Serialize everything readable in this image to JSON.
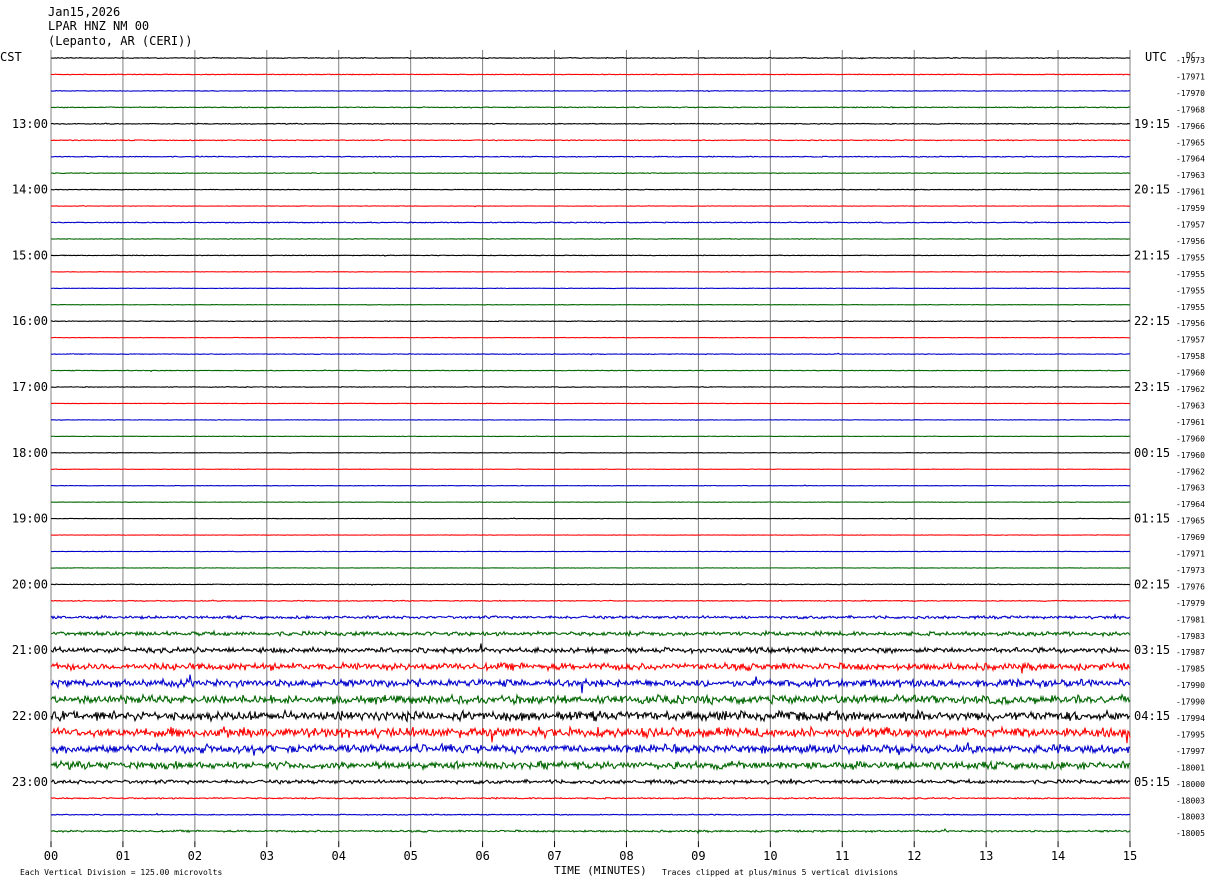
{
  "header": {
    "date": "Jan15,2026",
    "station": "LPAR HNZ NM 00",
    "location": "(Lepanto, AR (CERI))"
  },
  "left_tz": "CST",
  "right_tz": "UTC",
  "right_unit": "DC",
  "footer": {
    "scale_note": "Each Vertical Division =  125.00 microvolts",
    "xlabel": "TIME (MINUTES)",
    "clip_note": "Traces clipped at plus/minus 5 vertical divisions"
  },
  "colors": {
    "black": "#000000",
    "red": "#ff0000",
    "blue": "#0000cc",
    "green": "#006600",
    "grid": "#808080"
  },
  "chart_data": {
    "type": "line",
    "title": "LPAR HNZ NM 00 helicorder Jan15,2026",
    "xlabel": "TIME (MINUTES)",
    "xlim": [
      0,
      15
    ],
    "x_ticks": [
      "00",
      "01",
      "02",
      "03",
      "04",
      "05",
      "06",
      "07",
      "08",
      "09",
      "10",
      "11",
      "12",
      "13",
      "14",
      "15"
    ],
    "grid": true,
    "trace_colors": [
      "black",
      "red",
      "blue",
      "green"
    ],
    "rows": [
      {
        "cst": "",
        "utc": "",
        "dc": "-17973",
        "activity": 0.4
      },
      {
        "cst": "",
        "utc": "",
        "dc": "-17971",
        "activity": 0.3
      },
      {
        "cst": "",
        "utc": "",
        "dc": "-17970",
        "activity": 0.3
      },
      {
        "cst": "",
        "utc": "",
        "dc": "-17968",
        "activity": 0.4
      },
      {
        "cst": "13:00",
        "utc": "19:15",
        "dc": "-17966",
        "activity": 0.4
      },
      {
        "cst": "",
        "utc": "",
        "dc": "-17965",
        "activity": 0.4
      },
      {
        "cst": "",
        "utc": "",
        "dc": "-17964",
        "activity": 0.4
      },
      {
        "cst": "",
        "utc": "",
        "dc": "-17963",
        "activity": 0.3
      },
      {
        "cst": "14:00",
        "utc": "20:15",
        "dc": "-17961",
        "activity": 0.3
      },
      {
        "cst": "",
        "utc": "",
        "dc": "-17959",
        "activity": 0.2
      },
      {
        "cst": "",
        "utc": "",
        "dc": "-17957",
        "activity": 0.4
      },
      {
        "cst": "",
        "utc": "",
        "dc": "-17956",
        "activity": 0.3
      },
      {
        "cst": "15:00",
        "utc": "21:15",
        "dc": "-17955",
        "activity": 0.3
      },
      {
        "cst": "",
        "utc": "",
        "dc": "-17955",
        "activity": 0.2
      },
      {
        "cst": "",
        "utc": "",
        "dc": "-17955",
        "activity": 0.2
      },
      {
        "cst": "",
        "utc": "",
        "dc": "-17955",
        "activity": 0.2
      },
      {
        "cst": "16:00",
        "utc": "22:15",
        "dc": "-17956",
        "activity": 0.3
      },
      {
        "cst": "",
        "utc": "",
        "dc": "-17957",
        "activity": 0.2
      },
      {
        "cst": "",
        "utc": "",
        "dc": "-17958",
        "activity": 0.3
      },
      {
        "cst": "",
        "utc": "",
        "dc": "-17960",
        "activity": 0.3
      },
      {
        "cst": "17:00",
        "utc": "23:15",
        "dc": "-17962",
        "activity": 0.3
      },
      {
        "cst": "",
        "utc": "",
        "dc": "-17963",
        "activity": 0.2
      },
      {
        "cst": "",
        "utc": "",
        "dc": "-17961",
        "activity": 0.2
      },
      {
        "cst": "",
        "utc": "",
        "dc": "-17960",
        "activity": 0.2
      },
      {
        "cst": "18:00",
        "utc": "00:15",
        "dc": "-17960",
        "activity": 0.2
      },
      {
        "cst": "",
        "utc": "",
        "dc": "-17962",
        "activity": 0.2
      },
      {
        "cst": "",
        "utc": "",
        "dc": "-17963",
        "activity": 0.2
      },
      {
        "cst": "",
        "utc": "",
        "dc": "-17964",
        "activity": 0.2
      },
      {
        "cst": "19:00",
        "utc": "01:15",
        "dc": "-17965",
        "activity": 0.2
      },
      {
        "cst": "",
        "utc": "",
        "dc": "-17969",
        "activity": 0.2
      },
      {
        "cst": "",
        "utc": "",
        "dc": "-17971",
        "activity": 0.2
      },
      {
        "cst": "",
        "utc": "",
        "dc": "-17973",
        "activity": 0.2
      },
      {
        "cst": "20:00",
        "utc": "02:15",
        "dc": "-17976",
        "activity": 0.3
      },
      {
        "cst": "",
        "utc": "",
        "dc": "-17979",
        "activity": 0.4
      },
      {
        "cst": "",
        "utc": "",
        "dc": "-17981",
        "activity": 1.2
      },
      {
        "cst": "",
        "utc": "",
        "dc": "-17983",
        "activity": 1.8
      },
      {
        "cst": "21:00",
        "utc": "03:15",
        "dc": "-17987",
        "activity": 2.2
      },
      {
        "cst": "",
        "utc": "",
        "dc": "-17985",
        "activity": 3.0
      },
      {
        "cst": "",
        "utc": "",
        "dc": "-17990",
        "activity": 3.2
      },
      {
        "cst": "",
        "utc": "",
        "dc": "-17990",
        "activity": 3.6
      },
      {
        "cst": "22:00",
        "utc": "04:15",
        "dc": "-17994",
        "activity": 4.0
      },
      {
        "cst": "",
        "utc": "",
        "dc": "-17995",
        "activity": 4.2
      },
      {
        "cst": "",
        "utc": "",
        "dc": "-17997",
        "activity": 3.6
      },
      {
        "cst": "",
        "utc": "",
        "dc": "-18001",
        "activity": 3.2
      },
      {
        "cst": "23:00",
        "utc": "05:15",
        "dc": "-18000",
        "activity": 1.6
      },
      {
        "cst": "",
        "utc": "",
        "dc": "-18003",
        "activity": 0.6
      },
      {
        "cst": "",
        "utc": "",
        "dc": "-18003",
        "activity": 0.4
      },
      {
        "cst": "",
        "utc": "",
        "dc": "-18005",
        "activity": 0.8
      }
    ]
  }
}
